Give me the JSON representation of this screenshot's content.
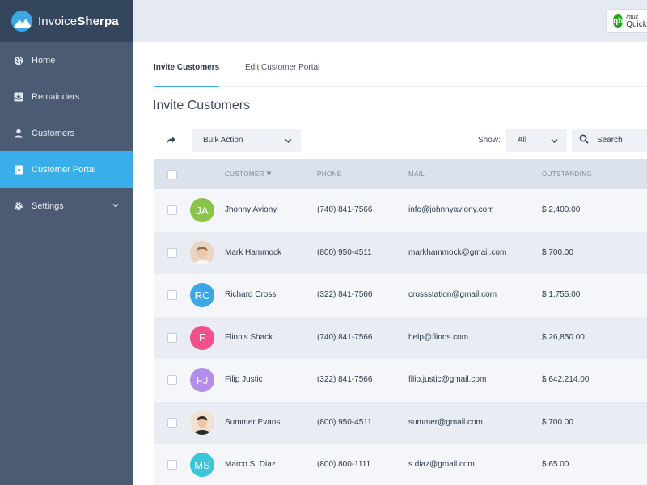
{
  "brand": {
    "name_light": "Invoice",
    "name_bold": "Sherpa"
  },
  "sidebar": {
    "items": [
      {
        "label": "Home",
        "icon": "globe-icon"
      },
      {
        "label": "Remainders",
        "icon": "inbox-icon"
      },
      {
        "label": "Customers",
        "icon": "user-icon"
      },
      {
        "label": "Customer Portal",
        "icon": "portal-icon",
        "active": true
      },
      {
        "label": "Settings",
        "icon": "gear-icon"
      }
    ]
  },
  "topbar": {
    "qb_intuit": "intuit",
    "qb_name": "QuickBooks",
    "qb_mark": "qb"
  },
  "tabs": [
    {
      "label": "Invite Customers",
      "active": true
    },
    {
      "label": "Edit Customer Portal",
      "active": false
    }
  ],
  "page_title": "Invite Customers",
  "toolbar": {
    "bulk_action": "Bulk Action",
    "show_label": "Show:",
    "show_value": "All",
    "search_placeholder": "Search"
  },
  "table": {
    "columns": {
      "customer": "CUSTOMER",
      "phone": "PHONE",
      "mail": "MAIL",
      "outstanding": "OUTSTANDING"
    },
    "rows": [
      {
        "initials": "JA",
        "avatar_color": "#8bc34a",
        "photo": false,
        "name": "Jhonny Aviony",
        "phone": "(740) 841-7566",
        "mail": "info@johnnyaviony.com",
        "outstanding": "$ 2,400.00"
      },
      {
        "initials": "",
        "avatar_color": "#e8d5c4",
        "photo": true,
        "name": "Mark Hammock",
        "phone": "(800) 950-4511",
        "mail": "markhammock@gmail.com",
        "outstanding": "$ 700.00"
      },
      {
        "initials": "RC",
        "avatar_color": "#3aa8e6",
        "photo": false,
        "name": "Richard Cross",
        "phone": "(322) 841-7566",
        "mail": "crossstation@gmail.com",
        "outstanding": "$ 1,755.00"
      },
      {
        "initials": "F",
        "avatar_color": "#f0508c",
        "photo": false,
        "name": "Flinn's Shack",
        "phone": "(740) 841-7566",
        "mail": "help@flinns.com",
        "outstanding": "$ 26,850.00"
      },
      {
        "initials": "FJ",
        "avatar_color": "#b38ee8",
        "photo": false,
        "name": "Filip Justic",
        "phone": "(322) 841-7566",
        "mail": "filip.justic@gmail.com",
        "outstanding": "$ 642,214.00"
      },
      {
        "initials": "",
        "avatar_color": "#f2e2d6",
        "photo": true,
        "name": "Summer Evans",
        "phone": "(800) 950-4511",
        "mail": "summer@gmail.com",
        "outstanding": "$ 700.00"
      },
      {
        "initials": "MS",
        "avatar_color": "#3cc4d8",
        "photo": false,
        "name": "Marco S. Diaz",
        "phone": "(800) 800-1111",
        "mail": "s.diaz@gmail.com",
        "outstanding": "$ 65.00"
      }
    ]
  }
}
